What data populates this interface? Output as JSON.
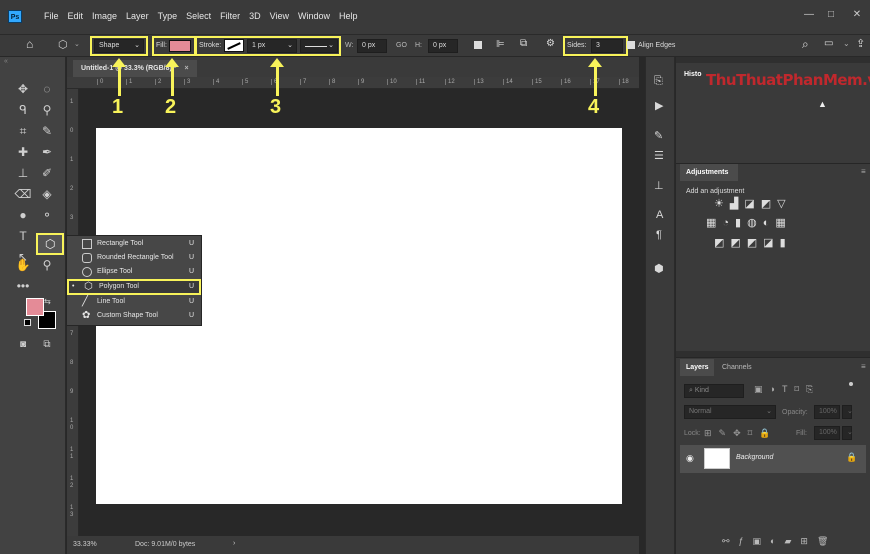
{
  "menu": {
    "logo": "Ps",
    "items": [
      "File",
      "Edit",
      "Image",
      "Layer",
      "Type",
      "Select",
      "Filter",
      "3D",
      "View",
      "Window",
      "Help"
    ],
    "win_min": "—",
    "win_max": "□",
    "win_close": "✕"
  },
  "options": {
    "mode": "Shape",
    "fill_label": "Fill:",
    "fill_color": "#e48b97",
    "stroke_label": "Stroke:",
    "stroke_width": "1 px",
    "w_label": "W:",
    "w_value": "0 px",
    "link": "GO",
    "h_label": "H:",
    "h_value": "0 px",
    "sides_label": "Sides:",
    "sides_value": "3",
    "align_edges": "Align Edges"
  },
  "callouts": [
    "1",
    "2",
    "3",
    "4"
  ],
  "document": {
    "tab_title": "Untitled-1 @ 33.3% (RGB/8) *",
    "tab_close": "×",
    "ruler_top": [
      "0",
      "1",
      "2",
      "3",
      "4",
      "5",
      "6",
      "7",
      "8",
      "9",
      "10",
      "11",
      "12",
      "13",
      "14",
      "15",
      "16",
      "17",
      "18"
    ],
    "ruler_left": [
      "1",
      "0",
      "1",
      "2",
      "3",
      "4",
      "5",
      "6",
      "7",
      "8",
      "9",
      "1\n0",
      "1\n1",
      "1\n2",
      "1\n3"
    ],
    "zoom": "33.33%",
    "doc_info": "Doc: 9.01M/0 bytes",
    "status_arrow": "›"
  },
  "flyout": {
    "items": [
      {
        "label": "Rectangle Tool",
        "key": "U"
      },
      {
        "label": "Rounded Rectangle Tool",
        "key": "U"
      },
      {
        "label": "Ellipse Tool",
        "key": "U"
      },
      {
        "label": "Polygon Tool",
        "key": "U"
      },
      {
        "label": "Line Tool",
        "key": "U"
      },
      {
        "label": "Custom Shape Tool",
        "key": "U"
      }
    ]
  },
  "colors": {
    "foreground": "#e48b97",
    "background": "#000000"
  },
  "panels": {
    "history_tab": "Histo",
    "watermark": "ThuThuatPhanMem.vn",
    "adjustments_tab": "Adjustments",
    "adjustments_hint": "Add an adjustment",
    "layers_tab": "Layers",
    "channels_tab": "Channels",
    "kind_label": "Kind",
    "blend_mode": "Normal",
    "opacity_label": "Opacity:",
    "opacity_value": "100%",
    "lock_label": "Lock:",
    "fill_label": "Fill:",
    "fill_value": "100%",
    "layer_name": "Background"
  }
}
